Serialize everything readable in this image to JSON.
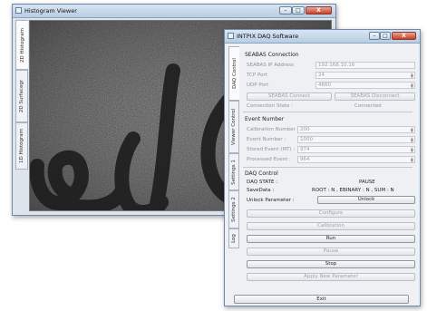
{
  "histogram_window": {
    "title": "Histogram Viewer",
    "minimize": "–",
    "maximize": "□",
    "close": "X",
    "tabs": [
      "2D Histogram",
      "2D Surfacegr",
      "1D Histogram"
    ]
  },
  "daq_window": {
    "title": "INTPIX DAQ Software",
    "minimize": "–",
    "maximize": "□",
    "close": "X",
    "tabs": [
      "DAQ Control",
      "Viewer Control",
      "Settings 1",
      "Settings 2",
      "Log"
    ],
    "seabas": {
      "title": "SEABAS Connection",
      "ip_label": "SEABAS IP Address",
      "ip_value": "192.168.10.16",
      "tcp_label": "TCP Port",
      "tcp_value": "24",
      "udp_label": "UDP Port",
      "udp_value": "4660",
      "connect_button": "SEABAS Connect",
      "disconnect_button": "SEABAS Disconnect",
      "state_label": "Connection State :",
      "state_value": "Connected"
    },
    "event_number": {
      "title": "Event Number",
      "calibration_label": "Calibration Number :",
      "calibration_value": "200",
      "event_label": "Event Number :",
      "event_value": "1000",
      "stored_label": "Stored Event (MT) :",
      "stored_value": "974",
      "processed_label": "Processed Event :",
      "processed_value": "964"
    },
    "daq_control": {
      "title": "DAQ Control",
      "state_label": "DAQ STATE :",
      "state_value": "PAUSE",
      "savedata_label": "SaveData :",
      "savedata_value": "ROOT : N , EBINARY : N , SUM : N",
      "unlock_label": "Unlock Parameter :",
      "unlock_button": "Unlock",
      "configure_button": "Configure",
      "calibration_button": "Calibration",
      "run_button": "Run",
      "pause_button": "Pause",
      "stop_button": "Stop",
      "apply_button": "Apply New Parameter"
    },
    "exit_button": "Exit"
  }
}
